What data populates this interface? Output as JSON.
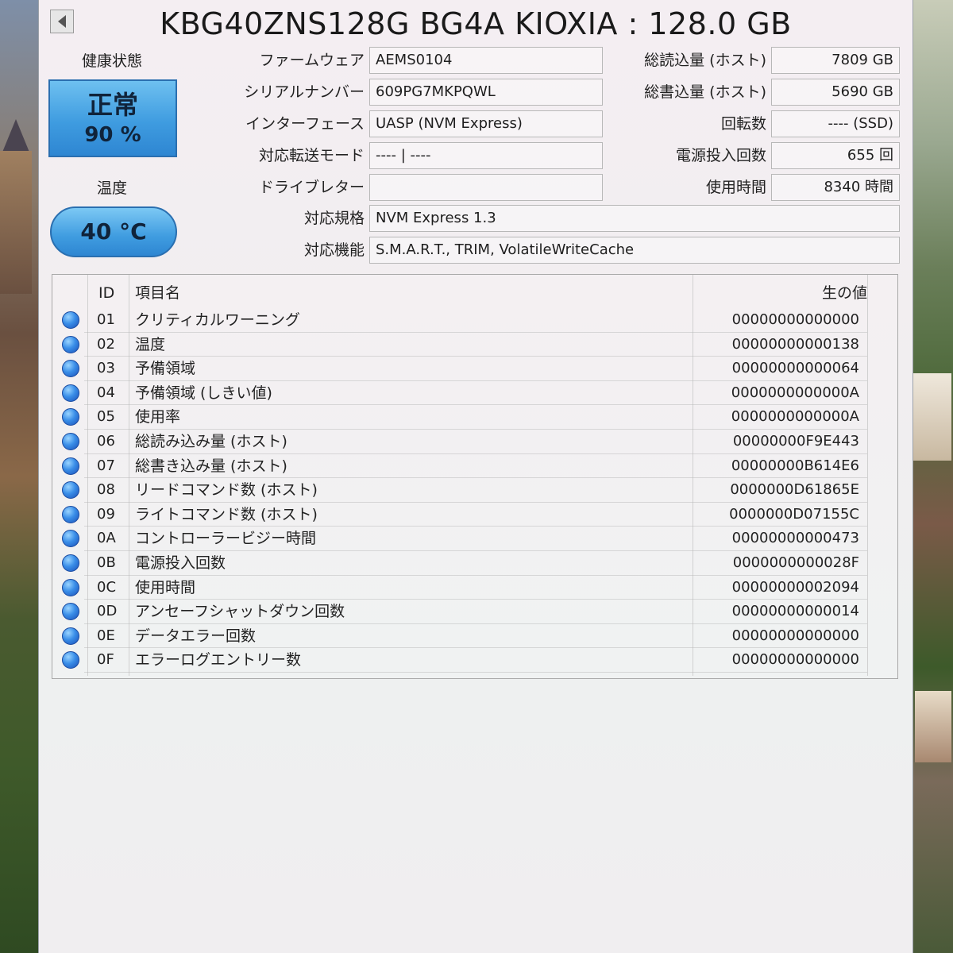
{
  "title": "KBG40ZNS128G BG4A KIOXIA : 128.0 GB",
  "health": {
    "label": "健康状態",
    "status": "正常",
    "percent": "90 %"
  },
  "temperature": {
    "label": "温度",
    "value": "40 °C"
  },
  "info_middle": [
    {
      "label": "ファームウェア",
      "value": "AEMS0104"
    },
    {
      "label": "シリアルナンバー",
      "value": "609PG7MKPQWL"
    },
    {
      "label": "インターフェース",
      "value": "UASP (NVM Express)"
    },
    {
      "label": "対応転送モード",
      "value": "---- | ----"
    },
    {
      "label": "ドライブレター",
      "value": ""
    }
  ],
  "info_right": [
    {
      "label": "総読込量 (ホスト)",
      "value": "7809 GB"
    },
    {
      "label": "総書込量 (ホスト)",
      "value": "5690 GB"
    },
    {
      "label": "回転数",
      "value": "---- (SSD)"
    },
    {
      "label": "電源投入回数",
      "value": "655 回"
    },
    {
      "label": "使用時間",
      "value": "8340 時間"
    }
  ],
  "standard": {
    "label": "対応規格",
    "value": "NVM Express 1.3"
  },
  "features": {
    "label": "対応機能",
    "value": "S.M.A.R.T., TRIM, VolatileWriteCache"
  },
  "table": {
    "headers": {
      "id": "ID",
      "name": "項目名",
      "raw": "生の値"
    },
    "rows": [
      {
        "id": "01",
        "name": "クリティカルワーニング",
        "raw": "00000000000000"
      },
      {
        "id": "02",
        "name": "温度",
        "raw": "00000000000138"
      },
      {
        "id": "03",
        "name": "予備領域",
        "raw": "00000000000064"
      },
      {
        "id": "04",
        "name": "予備領域 (しきい値)",
        "raw": "0000000000000A"
      },
      {
        "id": "05",
        "name": "使用率",
        "raw": "0000000000000A"
      },
      {
        "id": "06",
        "name": "総読み込み量 (ホスト)",
        "raw": "00000000F9E443"
      },
      {
        "id": "07",
        "name": "総書き込み量 (ホスト)",
        "raw": "00000000B614E6"
      },
      {
        "id": "08",
        "name": "リードコマンド数 (ホスト)",
        "raw": "0000000D61865E"
      },
      {
        "id": "09",
        "name": "ライトコマンド数 (ホスト)",
        "raw": "0000000D07155C"
      },
      {
        "id": "0A",
        "name": "コントローラービジー時間",
        "raw": "00000000000473"
      },
      {
        "id": "0B",
        "name": "電源投入回数",
        "raw": "0000000000028F"
      },
      {
        "id": "0C",
        "name": "使用時間",
        "raw": "00000000002094"
      },
      {
        "id": "0D",
        "name": "アンセーフシャットダウン回数",
        "raw": "00000000000014"
      },
      {
        "id": "0E",
        "name": "データエラー回数",
        "raw": "00000000000000"
      },
      {
        "id": "0F",
        "name": "エラーログエントリー数",
        "raw": "00000000000000"
      }
    ]
  },
  "colors": {
    "health_good": "#3f9ce0",
    "status_dot": "#1a50b8"
  },
  "icons": {
    "back": "left-triangle-icon",
    "status_dot": "blue-circle-icon"
  }
}
